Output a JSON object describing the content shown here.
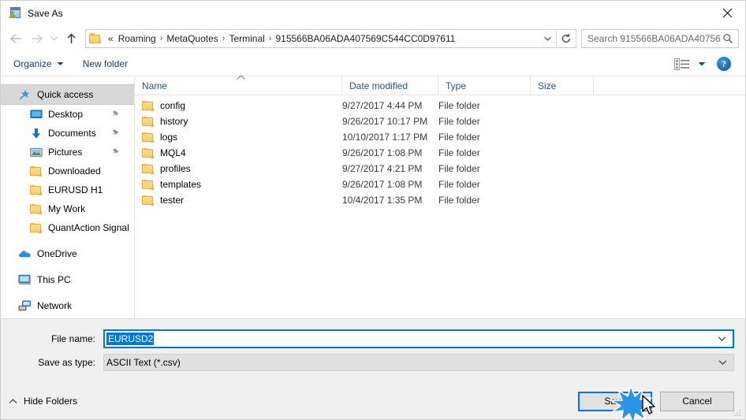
{
  "window": {
    "title": "Save As",
    "icon": "save-as-icon",
    "close_label": "✕"
  },
  "nav": {
    "back": "back-arrow",
    "forward": "forward-arrow",
    "recent": "recent-locations-chevron",
    "up": "up-arrow",
    "refresh": "refresh-icon",
    "address_dropdown": "chevron-down-icon",
    "breadcrumb_lead": "«",
    "breadcrumbs": [
      "Roaming",
      "MetaQuotes",
      "Terminal",
      "915566BA06ADA407569C544CC0D97611"
    ],
    "separator": "›"
  },
  "search": {
    "placeholder": "Search 915566BA06ADA40756...",
    "value": "",
    "icon": "search-icon"
  },
  "toolbar": {
    "organize_label": "Organize",
    "organize_caret": "chevron-down-icon",
    "new_folder_label": "New folder",
    "view_icon": "view-layout-icon",
    "view_caret": "chevron-down-icon",
    "help_label": "?"
  },
  "sidebar": {
    "items": [
      {
        "label": "Quick access",
        "icon": "star-pin-icon",
        "level": "root",
        "selected": true,
        "pinned": false
      },
      {
        "label": "Desktop",
        "icon": "desktop-icon",
        "level": "child",
        "selected": false,
        "pinned": true
      },
      {
        "label": "Documents",
        "icon": "documents-download-icon",
        "level": "child",
        "selected": false,
        "pinned": true
      },
      {
        "label": "Pictures",
        "icon": "pictures-icon",
        "level": "child",
        "selected": false,
        "pinned": true
      },
      {
        "label": "Downloaded",
        "icon": "folder-icon",
        "level": "child",
        "selected": false,
        "pinned": false
      },
      {
        "label": "EURUSD H1",
        "icon": "folder-icon",
        "level": "child",
        "selected": false,
        "pinned": false
      },
      {
        "label": "My Work",
        "icon": "folder-icon",
        "level": "child",
        "selected": false,
        "pinned": false
      },
      {
        "label": "QuantAction Signal",
        "icon": "folder-icon",
        "level": "child",
        "selected": false,
        "pinned": false
      },
      {
        "label": "OneDrive",
        "icon": "onedrive-cloud-icon",
        "level": "root",
        "selected": false,
        "pinned": false,
        "gap_before": true
      },
      {
        "label": "This PC",
        "icon": "this-pc-icon",
        "level": "root",
        "selected": false,
        "pinned": false,
        "gap_before": true
      },
      {
        "label": "Network",
        "icon": "network-icon",
        "level": "root",
        "selected": false,
        "pinned": false,
        "gap_before": true
      }
    ]
  },
  "filelist": {
    "columns": {
      "name": "Name",
      "date_modified": "Date modified",
      "type": "Type",
      "size": "Size"
    },
    "sort_indicator": "chevron-up-icon",
    "rows": [
      {
        "name": "config",
        "date": "9/27/2017 4:44 PM",
        "type": "File folder",
        "size": "",
        "icon": "folder-icon"
      },
      {
        "name": "history",
        "date": "9/26/2017 10:17 PM",
        "type": "File folder",
        "size": "",
        "icon": "folder-icon"
      },
      {
        "name": "logs",
        "date": "10/10/2017 1:17 PM",
        "type": "File folder",
        "size": "",
        "icon": "folder-icon"
      },
      {
        "name": "MQL4",
        "date": "9/26/2017 1:08 PM",
        "type": "File folder",
        "size": "",
        "icon": "folder-icon"
      },
      {
        "name": "profiles",
        "date": "9/27/2017 4:21 PM",
        "type": "File folder",
        "size": "",
        "icon": "folder-icon"
      },
      {
        "name": "templates",
        "date": "9/26/2017 1:08 PM",
        "type": "File folder",
        "size": "",
        "icon": "folder-icon"
      },
      {
        "name": "tester",
        "date": "10/4/2017 1:35 PM",
        "type": "File folder",
        "size": "",
        "icon": "folder-icon"
      }
    ]
  },
  "form": {
    "filename_label": "File name:",
    "filename_value": "EURUSD2",
    "filename_caret": "chevron-down-icon",
    "filetype_label": "Save as type:",
    "filetype_value": "ASCII Text (*.csv)",
    "filetype_caret": "chevron-down-icon"
  },
  "footer": {
    "hide_folders_label": "Hide Folders",
    "hide_folders_caret": "chevron-up-icon",
    "save_label": "Save",
    "cancel_label": "Cancel"
  },
  "colors": {
    "accent": "#0078d7",
    "selection": "#0078d7",
    "header_text": "#2b5580",
    "toolbar_text": "#1c3f63",
    "panel_bg": "#f0f0f0",
    "folder_yellow": "#f7cf6a"
  }
}
